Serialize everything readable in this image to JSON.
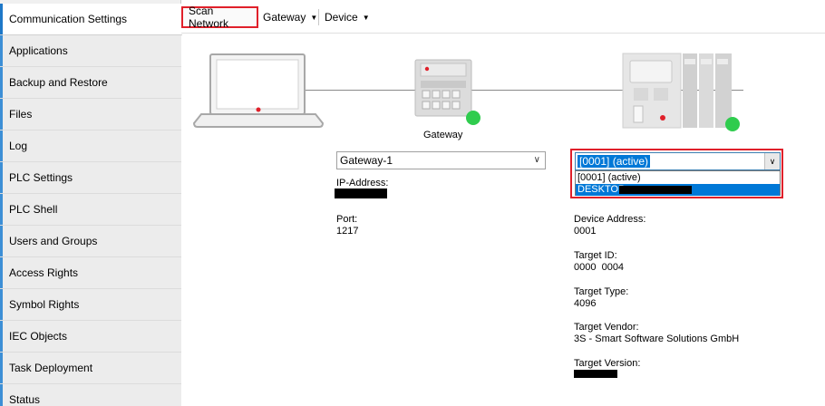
{
  "sidebar": {
    "items": [
      {
        "label": "Communication Settings",
        "active": true
      },
      {
        "label": "Applications"
      },
      {
        "label": "Backup and Restore"
      },
      {
        "label": "Files"
      },
      {
        "label": "Log"
      },
      {
        "label": "PLC Settings"
      },
      {
        "label": "PLC Shell"
      },
      {
        "label": "Users and Groups"
      },
      {
        "label": "Access Rights"
      },
      {
        "label": "Symbol Rights"
      },
      {
        "label": "IEC Objects"
      },
      {
        "label": "Task Deployment"
      },
      {
        "label": "Status"
      }
    ]
  },
  "toolbar": {
    "scan_label": "Scan Network",
    "gateway_label": "Gateway",
    "device_label": "Device"
  },
  "diagram": {
    "gateway_caption": "Gateway",
    "status_color": "#2fcc4e",
    "wire_color": "#8a8a8a"
  },
  "gateway": {
    "selected": "Gateway-1",
    "ip_label": "IP-Address:",
    "port_label": "Port:",
    "port_value": "1217"
  },
  "device": {
    "selected": "[0001] (active)",
    "options": [
      "[0001] (active)",
      "DESKTOP-"
    ],
    "address_label": "Device Address:",
    "address_value": "0001",
    "target_id_label": "Target ID:",
    "target_id_value": "0000  0004",
    "target_type_label": "Target Type:",
    "target_type_value": "4096",
    "target_vendor_label": "Target Vendor:",
    "target_vendor_value": "3S - Smart Software Solutions GmbH",
    "target_version_label": "Target Version:"
  },
  "colors": {
    "accent": "#1e78c8",
    "highlight": "#e0202a",
    "selection": "#0078d7"
  }
}
